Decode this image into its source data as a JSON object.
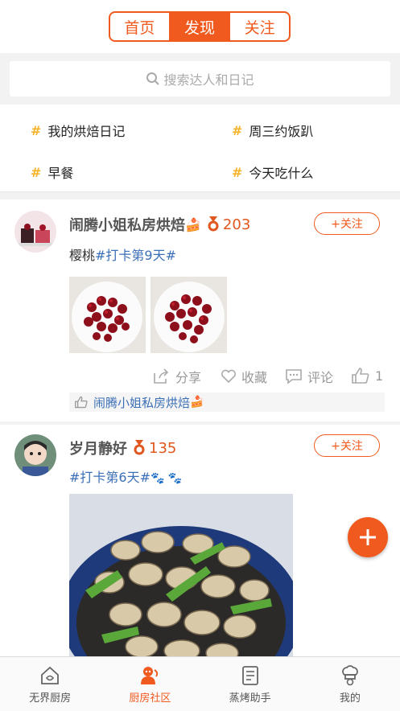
{
  "header": {
    "tabs": [
      {
        "label": "首页"
      },
      {
        "label": "发现",
        "active": true
      },
      {
        "label": "关注"
      }
    ]
  },
  "search": {
    "placeholder": "搜索达人和日记",
    "icon": "search-icon"
  },
  "topics": [
    {
      "label": "我的烘焙日记"
    },
    {
      "label": "周三约饭趴"
    },
    {
      "label": "早餐"
    },
    {
      "label": "今天吃什么"
    }
  ],
  "posts": [
    {
      "author": "闹腾小姐私房烘焙",
      "author_emoji": "🍰",
      "medal_count": "203",
      "follow_label": "+关注",
      "text_plain": "樱桃",
      "text_tag": "#打卡第9天#",
      "actions": {
        "share": "分享",
        "favorite": "收藏",
        "comment": "评论",
        "like_count": "1"
      },
      "liked_by": "闹腾小姐私房烘焙",
      "liked_by_emoji": "🍰"
    },
    {
      "author": "岁月静好",
      "medal_count": "135",
      "follow_label": "+关注",
      "text_tag": "#打卡第6天#",
      "text_emoji": "🐾 🐾"
    }
  ],
  "tabbar": [
    {
      "label": "无界厨房",
      "icon": "kitchen-house-icon"
    },
    {
      "label": "厨房社区",
      "icon": "community-person-icon",
      "active": true
    },
    {
      "label": "蒸烤助手",
      "icon": "recipe-note-icon"
    },
    {
      "label": "我的",
      "icon": "chef-hat-icon"
    }
  ],
  "colors": {
    "accent": "#f05a1e",
    "tag_blue": "#3b6fb6",
    "topic_hash": "#f5b428"
  }
}
